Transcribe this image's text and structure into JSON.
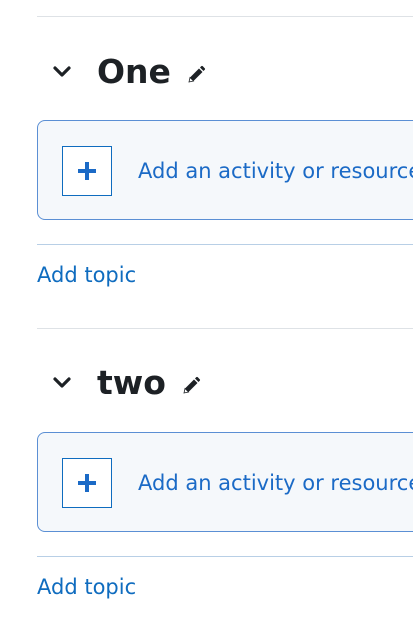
{
  "sections": [
    {
      "title": "One",
      "add_activity_label": "Add an activity or resource",
      "add_topic_label": "Add topic"
    },
    {
      "title": "two",
      "add_activity_label": "Add an activity or resource",
      "add_topic_label": "Add topic"
    }
  ],
  "icons": {
    "collapse": "chevron-down-icon",
    "edit": "pencil-icon",
    "add": "plus-icon"
  },
  "colors": {
    "link": "#0f6cbf",
    "heading": "#1d2125",
    "box_border": "#5b8fd4",
    "box_bg": "#f5f8fb"
  }
}
